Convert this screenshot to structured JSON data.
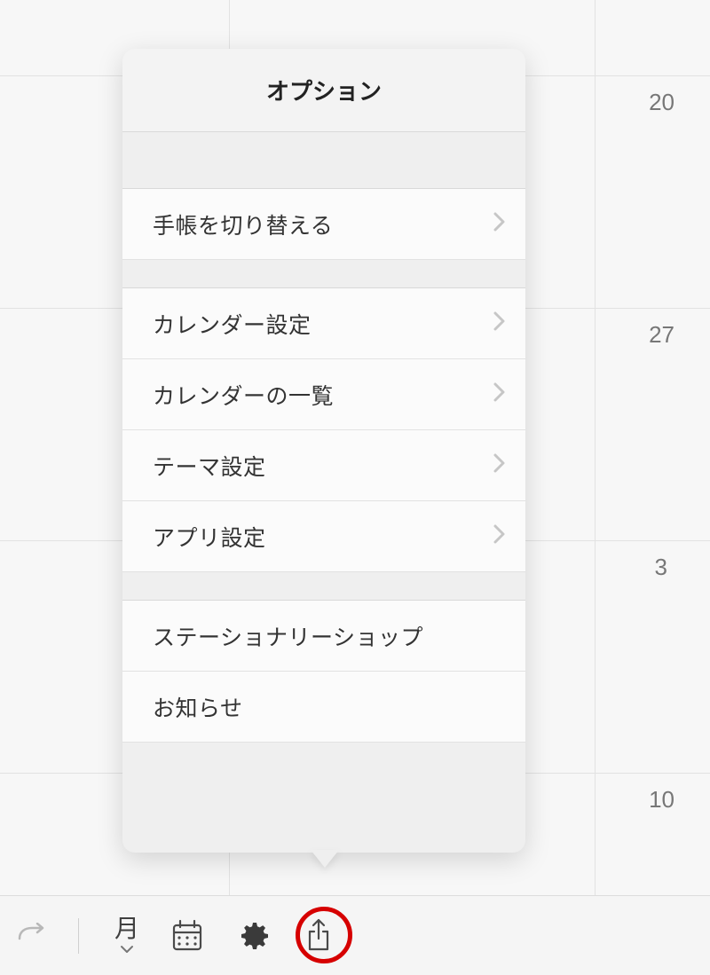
{
  "calendar": {
    "dates": [
      "20",
      "27",
      "3",
      "10"
    ]
  },
  "popover": {
    "title": "オプション",
    "items1": [
      {
        "label": "手帳を切り替える",
        "chevron": true
      }
    ],
    "items2": [
      {
        "label": "カレンダー設定",
        "chevron": true
      },
      {
        "label": "カレンダーの一覧",
        "chevron": true
      },
      {
        "label": "テーマ設定",
        "chevron": true
      },
      {
        "label": "アプリ設定",
        "chevron": true
      }
    ],
    "items3": [
      {
        "label": "ステーショナリーショップ",
        "chevron": false
      },
      {
        "label": "お知らせ",
        "chevron": false
      }
    ]
  },
  "toolbar": {
    "view_label": "月"
  }
}
